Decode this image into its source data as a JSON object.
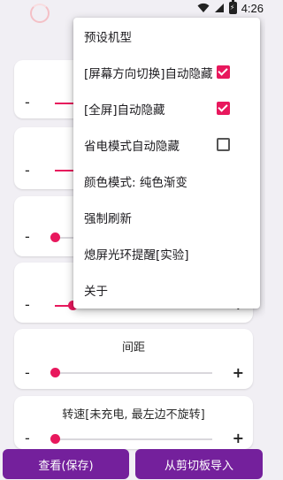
{
  "status_bar": {
    "time": "4:26",
    "battery_glyph": "⚡"
  },
  "menu": {
    "items": [
      {
        "label": "预设机型",
        "checkbox": null
      },
      {
        "label": "[屏幕方向切换]自动隐藏",
        "checkbox": true
      },
      {
        "label": "[全屏]自动隐藏",
        "checkbox": true
      },
      {
        "label": "省电模式自动隐藏",
        "checkbox": false
      },
      {
        "label": "颜色模式: 纯色渐变",
        "checkbox": null
      },
      {
        "label": "强制刷新",
        "checkbox": null
      },
      {
        "label": "熄屏光环提醒[实验]",
        "checkbox": null
      },
      {
        "label": "关于",
        "checkbox": null
      }
    ]
  },
  "sliders": [
    {
      "title": "",
      "value_fraction": 0.27
    },
    {
      "title": "",
      "value_fraction": 0.22
    },
    {
      "title": "",
      "value_fraction": 0.0
    },
    {
      "title": "",
      "value_fraction": 0.11
    },
    {
      "title": "间距",
      "value_fraction": 0.0
    },
    {
      "title": "转速[未充电, 最左边不旋转]",
      "value_fraction": 0.0
    }
  ],
  "controls": {
    "minus": "-",
    "plus": "+"
  },
  "buttons": {
    "view_save": "查看(保存)",
    "import_clipboard": "从剪切板导入"
  },
  "colors": {
    "accent": "#e8185d",
    "button": "#74209c",
    "background": "#f1eff4"
  }
}
